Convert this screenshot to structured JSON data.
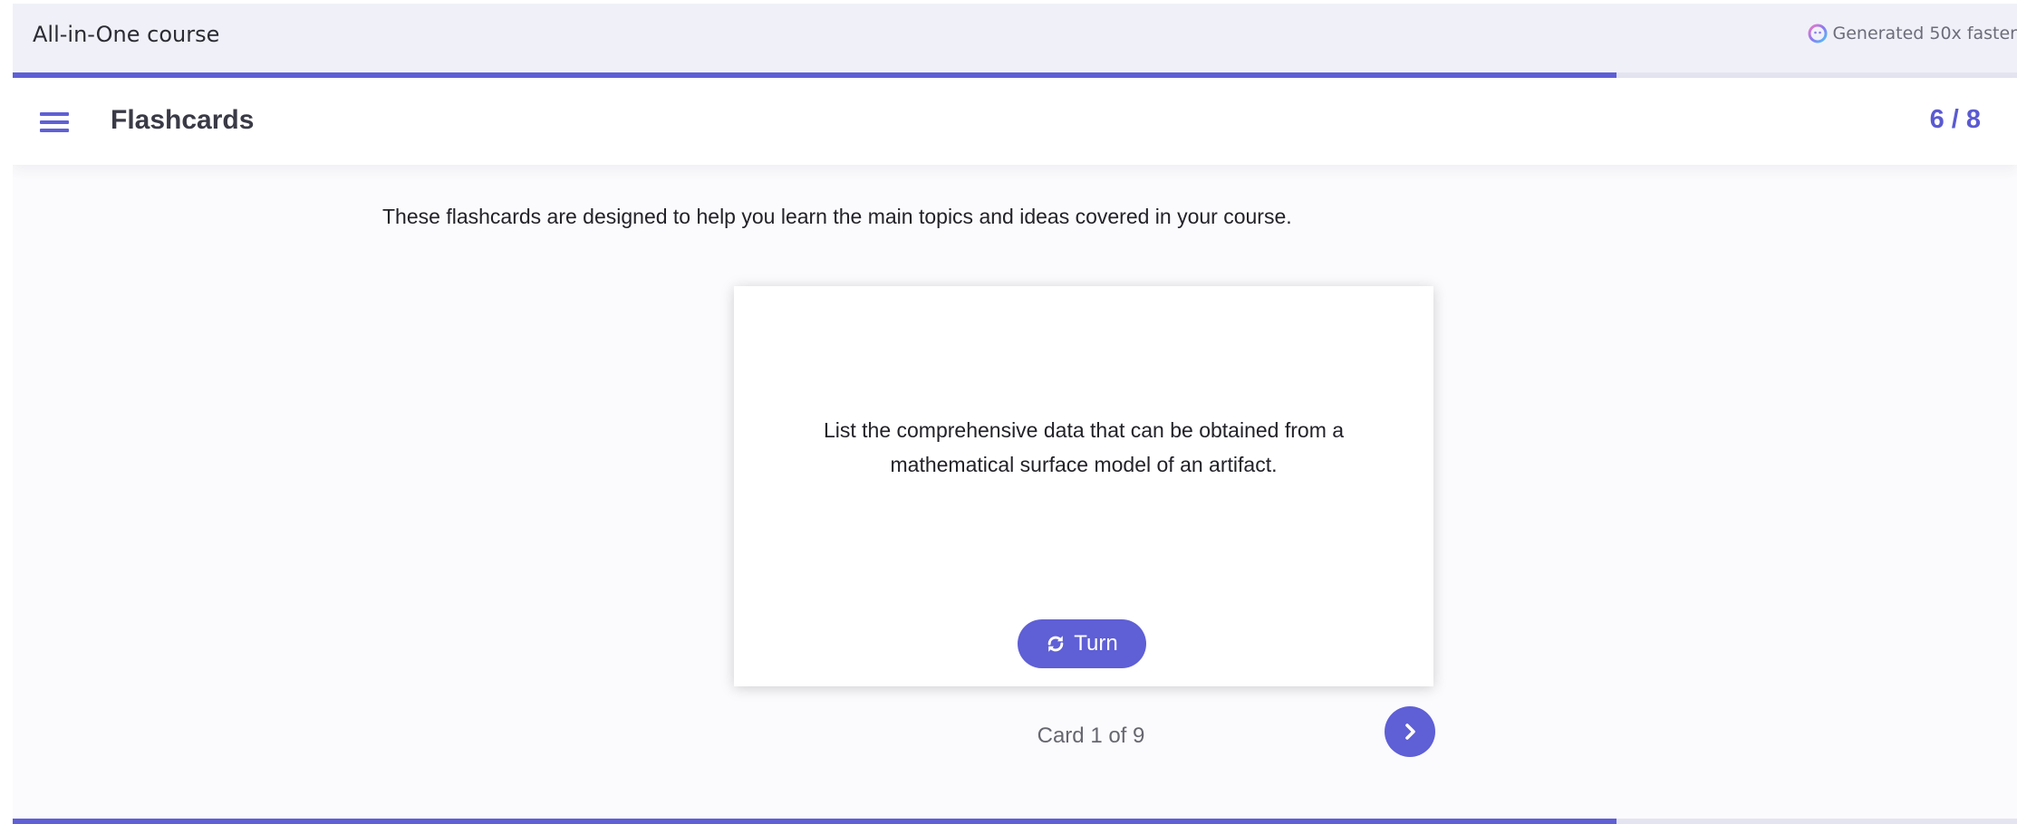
{
  "app": {
    "course_title": "All-in-One course",
    "brand_text": "Generated 50x faster"
  },
  "progress": {
    "fraction": 0.8,
    "color": "#5f5fd6"
  },
  "header": {
    "menu_icon": "hamburger-menu-icon",
    "section_title": "Flashcards",
    "page_counter": "6 / 8"
  },
  "main": {
    "intro": "These flashcards are designed to help you learn the main topics and ideas covered in your course.",
    "card": {
      "question": "List the comprehensive data that can be obtained from a mathematical surface model of an artifact.",
      "turn_label": "Turn",
      "turn_icon": "refresh-icon"
    },
    "card_counter": "Card 1 of 9",
    "next_icon": "chevron-right-icon"
  },
  "colors": {
    "accent": "#5f5fd6",
    "topbar_bg": "#f0f1f8"
  }
}
